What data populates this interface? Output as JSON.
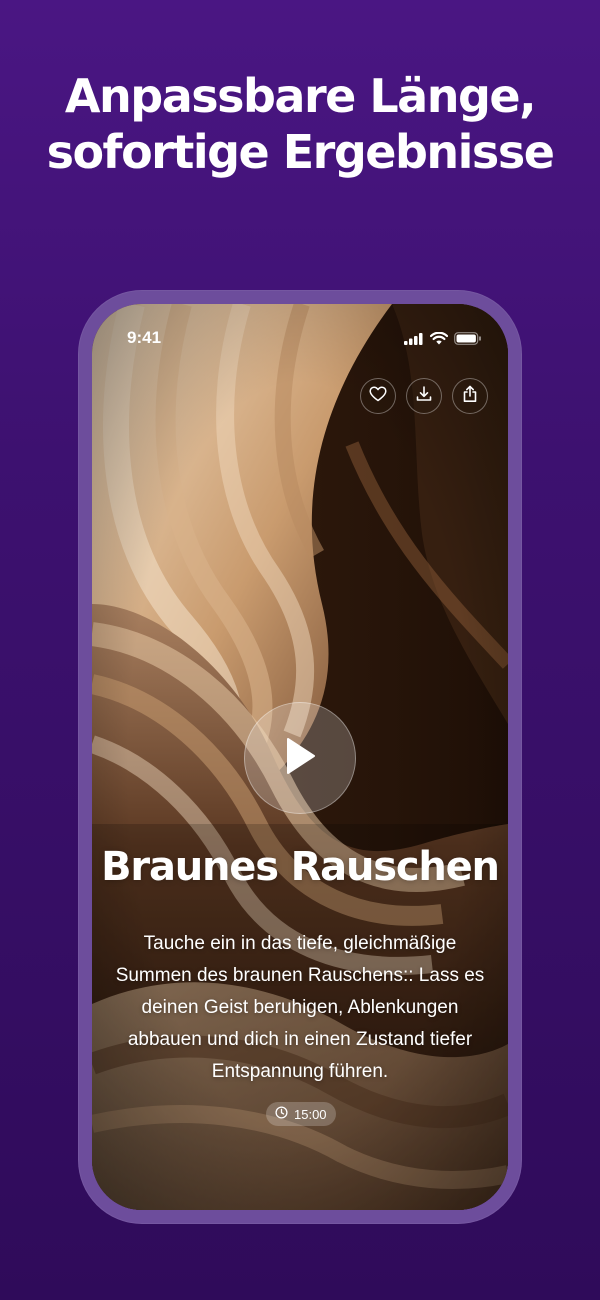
{
  "headline": {
    "line1": "Anpassbare Länge,",
    "line2": "sofortige Ergebnisse"
  },
  "status_bar": {
    "time": "9:41",
    "icons": [
      "signal-icon",
      "wifi-icon",
      "battery-icon"
    ]
  },
  "actions": [
    {
      "name": "favorite",
      "icon": "heart-icon"
    },
    {
      "name": "download",
      "icon": "download-icon"
    },
    {
      "name": "share",
      "icon": "share-icon"
    }
  ],
  "player": {
    "play_icon": "play-icon",
    "title": "Braunes Rauschen",
    "description": "Tauche ein in das tiefe, gleichmäßige Summen des braunen Rauschens:: Lass es deinen Geist beruhigen, Ablenkungen abbauen und dich in einen Zustand tiefer Entspannung führen.",
    "duration": "15:00",
    "duration_icon": "clock-icon"
  },
  "colors": {
    "background_top": "#4a1683",
    "background_bottom": "#2f0b5a",
    "phone_frame": "#6d4d9c",
    "artwork_light": "#e8c9a6",
    "artwork_dark": "#2a170c"
  }
}
